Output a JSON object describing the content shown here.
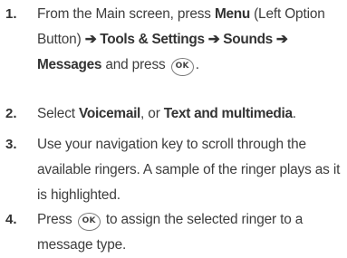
{
  "steps": [
    {
      "number": "1.",
      "parts": {
        "t1": "From the Main screen, press ",
        "b1": "Menu",
        "t2": " (Left Option Button) ",
        "b2": "➔ Tools & Settings ➔ Sounds ➔",
        "b3": "Messages",
        "t3": " and press ",
        "t4": "."
      }
    },
    {
      "number": "2.",
      "parts": {
        "t1": "Select ",
        "b1": "Voicemail",
        "t2": ", or ",
        "b2": "Text and multimedia",
        "t3": "."
      }
    },
    {
      "number": "3.",
      "parts": {
        "t1": "Use your navigation key to scroll through the available ringers. A sample of the ringer plays as it is highlighted."
      }
    },
    {
      "number": "4.",
      "parts": {
        "t1": "Press ",
        "t2": " to assign the selected ringer to a message type."
      }
    }
  ],
  "ok_key": {
    "label": "OK",
    "icon": "ok-key-icon"
  }
}
